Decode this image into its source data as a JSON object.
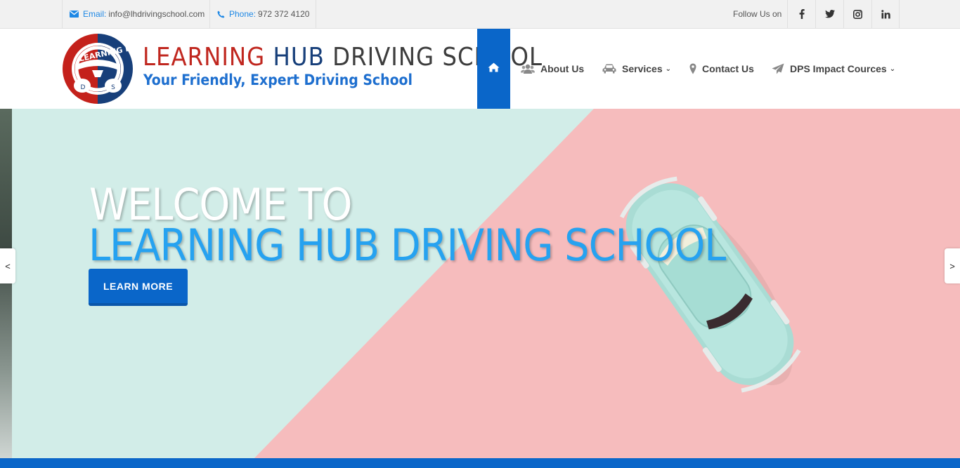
{
  "topbar": {
    "email_label": "Email:",
    "email_value": "info@lhdrivingschool.com",
    "phone_label": "Phone:",
    "phone_value": "972 372 4120",
    "follow_label": "Follow Us on",
    "social": [
      "f",
      "t",
      "ig",
      "in"
    ]
  },
  "brand": {
    "title_part1": "LEARNING",
    "title_part2": "HUB",
    "title_part3": "DRIVING SCHOOL",
    "subtitle": "Your Friendly, Expert Driving School",
    "logo_text": "LEARNING HUB",
    "logo_letters": [
      "D",
      "S"
    ]
  },
  "nav": {
    "items": [
      {
        "label": "About Us",
        "icon": "users-icon"
      },
      {
        "label": "Services",
        "icon": "car-icon",
        "dropdown": true
      },
      {
        "label": "Contact Us",
        "icon": "map-marker-icon"
      },
      {
        "label": "DPS Impact Cources",
        "icon": "paper-plane-icon",
        "dropdown": true
      }
    ]
  },
  "hero": {
    "line1": "WELCOME TO",
    "line2": "LEARNING HUB DRIVING SCHOOL",
    "cta": "LEARN MORE",
    "prev": "<",
    "next": ">"
  },
  "colors": {
    "accent": "#0a66c9",
    "brand_red": "#c0271f",
    "brand_blue": "#173f7a",
    "hero_mint": "#d2ede8",
    "hero_pink": "#f7c0c0"
  }
}
